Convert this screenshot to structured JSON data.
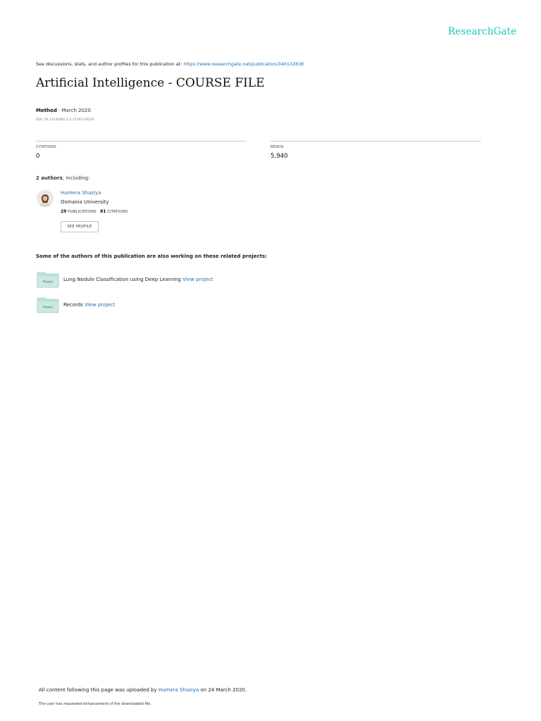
{
  "header": {
    "brand": "ResearchGate"
  },
  "notice": {
    "text": "See discussions, stats, and author profiles for this publication at: ",
    "url": "https://www.researchgate.net/publication/340132838"
  },
  "publication": {
    "title": "Artificial Intelligence - COURSE FILE",
    "type": "Method",
    "separator": " · ",
    "date": "March 2020",
    "doi": "DOI: 10.13140/RG.2.2.17165.49120"
  },
  "stats": {
    "citations_label": "CITATIONS",
    "citations_value": "0",
    "reads_label": "READS",
    "reads_value": "5,940"
  },
  "authors": {
    "count_text": "2 authors",
    "suffix": ", including:",
    "items": [
      {
        "name": "Humera Shaziya",
        "institution": "Osmania University",
        "publications_count": "29",
        "publications_label": "PUBLICATIONS",
        "citations_count": "81",
        "citations_label": "CITATIONS",
        "button_label": "SEE PROFILE"
      }
    ]
  },
  "related": {
    "heading": "Some of the authors of this publication are also working on these related projects:",
    "icon_label": "Project",
    "view_label": "View project",
    "projects": [
      {
        "name": "Lung Nodule Classification using Deep Learning"
      },
      {
        "name": "Records"
      }
    ]
  },
  "footer": {
    "upload_prefix": "All content following this page was uploaded by ",
    "uploader": "Humera Shaziya",
    "upload_suffix": " on 24 March 2020.",
    "enhancement_note": "The user has requested enhancement of the downloaded file."
  },
  "colors": {
    "brand": "#20c5b4",
    "link": "#1f6fb2",
    "project_folder": "#bfe3dc"
  }
}
